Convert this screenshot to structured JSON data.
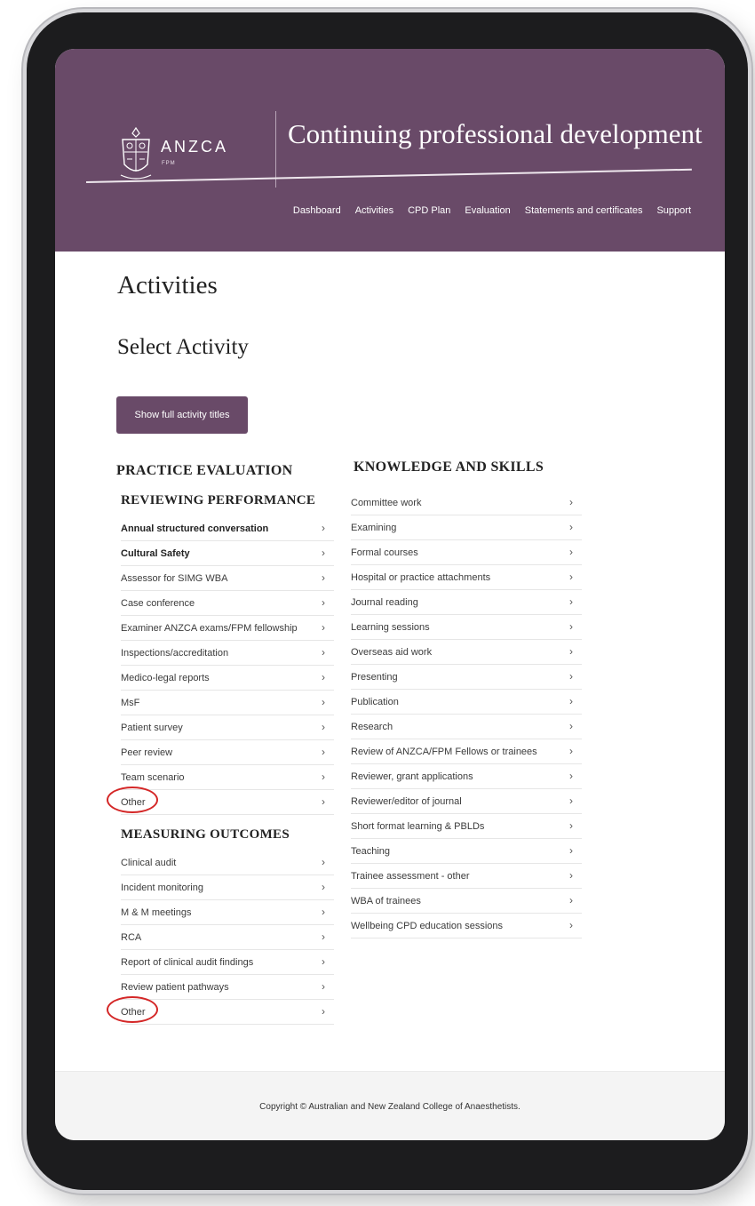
{
  "header": {
    "logo_text": "ANZCA",
    "logo_sub": "FPM",
    "title": "Continuing professional development"
  },
  "nav": [
    "Dashboard",
    "Activities",
    "CPD Plan",
    "Evaluation",
    "Statements and certificates",
    "Support"
  ],
  "page": {
    "heading": "Activities",
    "subheading": "Select Activity",
    "show_button": "Show full activity titles"
  },
  "practice_evaluation": {
    "title": "PRACTICE EVALUATION",
    "reviewing": {
      "title": "REVIEWING PERFORMANCE",
      "items": [
        "Annual structured conversation",
        "Cultural Safety",
        "Assessor for SIMG WBA",
        "Case conference",
        "Examiner ANZCA exams/FPM fellowship",
        "Inspections/accreditation",
        "Medico-legal reports",
        "MsF",
        "Patient survey",
        "Peer review",
        "Team scenario",
        "Other"
      ]
    },
    "measuring": {
      "title": "MEASURING OUTCOMES",
      "items": [
        "Clinical audit",
        "Incident monitoring",
        "M & M meetings",
        "RCA",
        "Report of clinical audit findings",
        "Review patient pathways",
        "Other"
      ]
    }
  },
  "knowledge": {
    "title": "KNOWLEDGE AND SKILLS",
    "items": [
      "Committee work",
      "Examining",
      "Formal courses",
      "Hospital or practice attachments",
      "Journal reading",
      "Learning sessions",
      "Overseas aid work",
      "Presenting",
      "Publication",
      "Research",
      "Review of ANZCA/FPM Fellows or trainees",
      "Reviewer, grant applications",
      "Reviewer/editor of journal",
      "Short format learning & PBLDs",
      "Teaching",
      "Trainee assessment - other",
      "WBA of trainees",
      "Wellbeing CPD education sessions"
    ]
  },
  "chevron": "›",
  "footer": "Copyright © Australian and New Zealand College of Anaesthetists.",
  "colors": {
    "brand": "#694a68",
    "highlight": "#d42727"
  }
}
